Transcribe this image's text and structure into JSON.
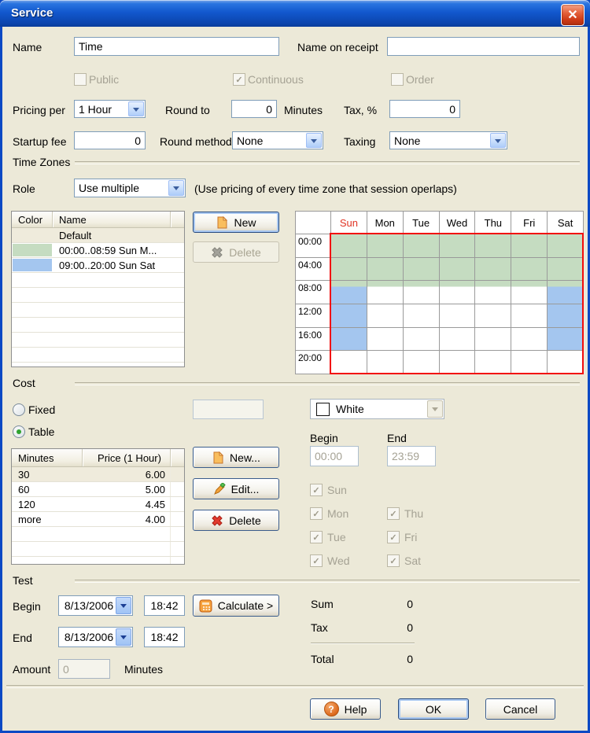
{
  "window": {
    "title": "Service",
    "close_glyph": "✕"
  },
  "header_fields": {
    "name_label": "Name",
    "name_value": "Time",
    "receipt_label": "Name on receipt",
    "receipt_value": "",
    "public_label": "Public",
    "continuous_label": "Continuous",
    "order_label": "Order",
    "continuous_check": "✓",
    "pricing_per_label": "Pricing per",
    "pricing_per_value": "1 Hour",
    "round_to_label": "Round to",
    "round_to_value": "0",
    "minutes_label": "Minutes",
    "tax_label": "Tax, %",
    "tax_value": "0",
    "startup_fee_label": "Startup fee",
    "startup_fee_value": "0",
    "round_method_label": "Round method",
    "round_method_value": "None",
    "taxing_label": "Taxing",
    "taxing_value": "None"
  },
  "time_zones": {
    "section_label": "Time Zones",
    "role_label": "Role",
    "role_value": "Use multiple",
    "role_hint": "(Use pricing of every time zone that session operlaps)",
    "list_headers": [
      "Color",
      "Name"
    ],
    "zones": [
      {
        "color": "",
        "name": "Default",
        "selected": true
      },
      {
        "color": "#C5DCC1",
        "name": "00:00..08:59 Sun M...",
        "selected": false
      },
      {
        "color": "#A4C6EF",
        "name": "09:00..20:00 Sun Sat",
        "selected": false
      }
    ],
    "new_label": "New",
    "delete_label": "Delete",
    "week_grid": {
      "days": [
        "Sun",
        "Mon",
        "Tue",
        "Wed",
        "Thu",
        "Fri",
        "Sat"
      ],
      "times": [
        "00:00",
        "04:00",
        "08:00",
        "12:00",
        "16:00",
        "20:00"
      ],
      "cells": [
        [
          "g",
          "g",
          "g",
          "g",
          "g",
          "g",
          "g"
        ],
        [
          "g",
          "g",
          "g",
          "g",
          "g",
          "g",
          "g"
        ],
        [
          "gb",
          "gw",
          "gw",
          "gw",
          "gw",
          "gw",
          "gb"
        ],
        [
          "b",
          "w",
          "w",
          "w",
          "w",
          "w",
          "b"
        ],
        [
          "b",
          "w",
          "w",
          "w",
          "w",
          "w",
          "b"
        ],
        [
          "w",
          "w",
          "w",
          "w",
          "w",
          "w",
          "w"
        ]
      ],
      "zone_colors": {
        "g": "#C5DCC1",
        "b": "#A4C6EF",
        "w": "#FFFFFF"
      }
    }
  },
  "cost": {
    "section_label": "Cost",
    "fixed_label": "Fixed",
    "fixed_value": "",
    "table_label": "Table",
    "table_headers": [
      "Minutes",
      "Price (1 Hour)"
    ],
    "price_rows": [
      [
        "30",
        "6.00"
      ],
      [
        "60",
        "5.00"
      ],
      [
        "120",
        "4.45"
      ],
      [
        "more",
        "4.00"
      ]
    ],
    "new_label": "New...",
    "edit_label": "Edit...",
    "delete_label": "Delete",
    "color_value": "White",
    "begin_label": "Begin",
    "begin_value": "00:00",
    "end_label": "End",
    "end_value": "23:59",
    "day_checks_left": [
      "Sun",
      "Mon",
      "Tue",
      "Wed"
    ],
    "day_checks_right": [
      "Thu",
      "Fri",
      "Sat"
    ],
    "day_check_glyph": "✓"
  },
  "test": {
    "section_label": "Test",
    "begin_label": "Begin",
    "begin_date": "8/13/2006",
    "begin_time": "18:42",
    "end_label": "End",
    "end_date": "8/13/2006",
    "end_time": "18:42",
    "calculate_label": "Calculate >",
    "amount_label": "Amount",
    "amount_value": "0",
    "amount_suffix": "Minutes"
  },
  "totals": {
    "sum_label": "Sum",
    "sum_value": "0",
    "tax_label": "Tax",
    "tax_value": "0",
    "total_label": "Total",
    "total_value": "0"
  },
  "footer": {
    "help_label": "Help",
    "ok_label": "OK",
    "cancel_label": "Cancel"
  }
}
